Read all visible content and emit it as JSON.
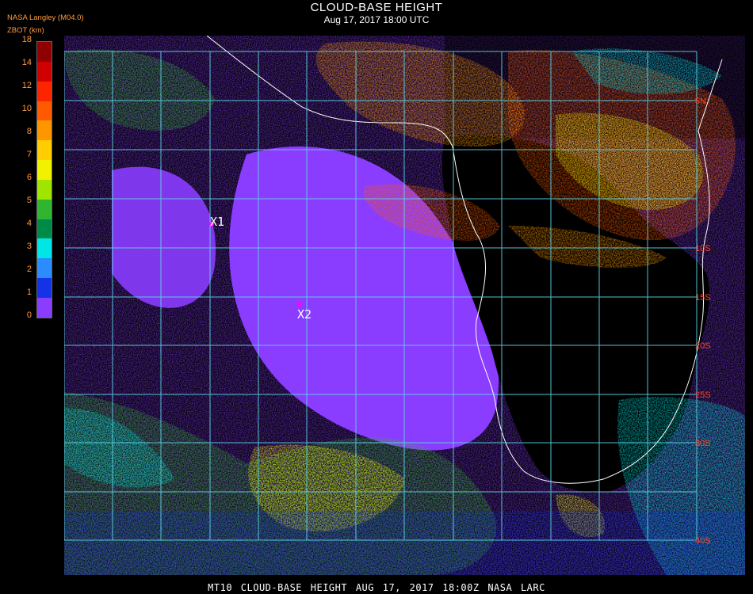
{
  "header": {
    "title": "CLOUD-BASE HEIGHT",
    "subtitle": "Aug 17, 2017 18:00 UTC",
    "credit": "NASA Langley (M04.0)",
    "unit": "ZBOT (km)"
  },
  "legend": {
    "ticks": [
      "18",
      "14",
      "12",
      "10",
      "8",
      "7",
      "6",
      "5",
      "4",
      "3",
      "2",
      "1",
      "0"
    ],
    "colors": [
      "#8f0000",
      "#d10000",
      "#ff2400",
      "#ff5a00",
      "#ff9600",
      "#ffcd00",
      "#f2f200",
      "#9fe500",
      "#2fb52f",
      "#008a48",
      "#00e5e5",
      "#2a8cff",
      "#1433e6",
      "#8a3cff"
    ]
  },
  "map": {
    "lat_labels": [
      "5N",
      "",
      "10S",
      "15S",
      "20S",
      "25S",
      "30S",
      "",
      "40S"
    ],
    "markers": [
      {
        "id": "X1",
        "label": "X1",
        "color": "#ff00ff"
      },
      {
        "id": "X2",
        "label": "X2",
        "color": "#ff00ff"
      }
    ],
    "grid_color": "#5fd4e6"
  },
  "footer": {
    "text": "MT10  CLOUD-BASE HEIGHT   AUG 17, 2017 18:00Z   NASA LARC"
  }
}
